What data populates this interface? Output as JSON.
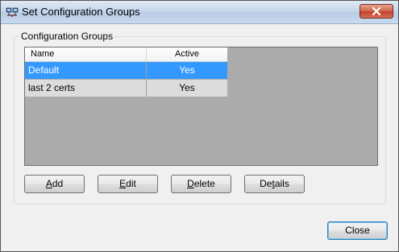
{
  "window": {
    "title": "Set Configuration Groups",
    "icon": "network-config-icon"
  },
  "groupbox": {
    "title": "Configuration Groups"
  },
  "grid": {
    "columns": [
      "Name",
      "Active"
    ],
    "rows": [
      {
        "name": "Default",
        "active": "Yes",
        "selected": true
      },
      {
        "name": "last 2 certs",
        "active": "Yes",
        "selected": false
      }
    ]
  },
  "buttons": {
    "add": {
      "label": "Add",
      "mnemonic": "A",
      "rest": "dd"
    },
    "edit": {
      "label": "Edit",
      "mnemonic": "E",
      "rest": "dit"
    },
    "delete": {
      "label": "Delete",
      "mnemonic": "D",
      "rest": "elete"
    },
    "details": {
      "label": "Details",
      "pre": "De",
      "mnemonic": "t",
      "rest": "ails"
    },
    "close": {
      "label": "Close"
    }
  },
  "colors": {
    "selection": "#3399ff",
    "grid_background": "#ababab",
    "close_button": "#c4412a"
  }
}
